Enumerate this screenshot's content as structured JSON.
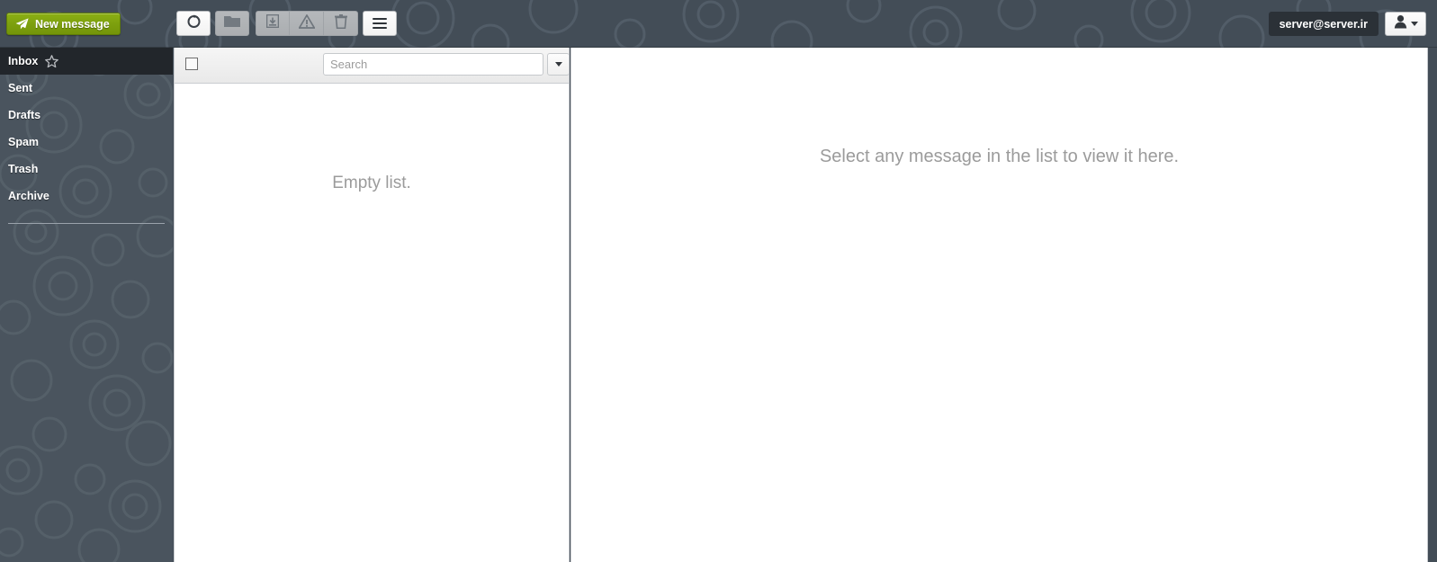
{
  "toolbar": {
    "new_message_label": "New message",
    "new_message_icon": "paper-plane-icon",
    "buttons": [
      {
        "name": "refresh-button",
        "icon": "refresh-circle-icon",
        "state": "enabled"
      },
      {
        "name": "folder-button",
        "icon": "folder-icon",
        "state": "disabled"
      },
      {
        "name": "archive-button",
        "icon": "archive-box-icon",
        "state": "disabled"
      },
      {
        "name": "junk-button",
        "icon": "warning-triangle-icon",
        "state": "disabled"
      },
      {
        "name": "delete-button",
        "icon": "trash-icon",
        "state": "disabled"
      },
      {
        "name": "options-button",
        "icon": "hamburger-menu-icon",
        "state": "enabled"
      }
    ]
  },
  "account": {
    "email": "server@server.ir",
    "menu_icon": "user-icon",
    "caret_icon": "chevron-down-icon"
  },
  "sidebar": {
    "items": [
      {
        "label": "Inbox",
        "selected": true,
        "icon": "star-outline-icon"
      },
      {
        "label": "Sent",
        "selected": false,
        "icon": ""
      },
      {
        "label": "Drafts",
        "selected": false,
        "icon": ""
      },
      {
        "label": "Spam",
        "selected": false,
        "icon": ""
      },
      {
        "label": "Trash",
        "selected": false,
        "icon": ""
      },
      {
        "label": "Archive",
        "selected": false,
        "icon": ""
      }
    ]
  },
  "message_list": {
    "select_all_checkbox": "unchecked",
    "search": {
      "placeholder": "Search",
      "value": "",
      "dropdown_icon": "chevron-down-icon"
    },
    "empty_text": "Empty list.",
    "rows": []
  },
  "preview": {
    "placeholder_text": "Select any message in the list to view it here."
  },
  "colors": {
    "header_bg": "#434d57",
    "sidebar_bg": "#4a545e",
    "sidebar_selected_bg": "#22262b",
    "accent_green": "#7da00e",
    "panel_bg": "#ffffff",
    "muted_text": "#9b9b9b"
  }
}
